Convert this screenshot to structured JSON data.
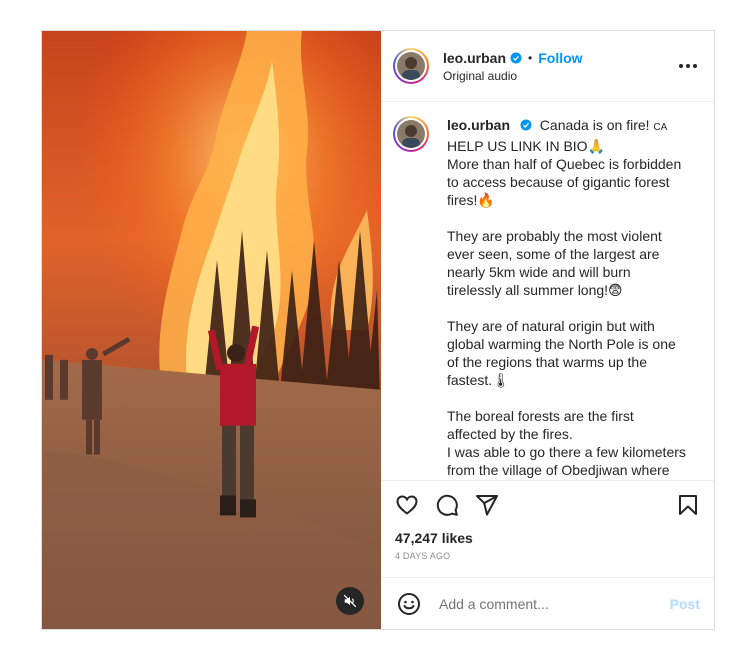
{
  "post": {
    "author": {
      "username": "leo.urban",
      "verified_icon": "verified-badge-icon",
      "separator": "•",
      "follow_label": "Follow",
      "audio_label": "Original audio"
    },
    "media": {
      "description_icon": "wildfire-video",
      "mute_icon": "speaker-muted-icon"
    },
    "caption": {
      "username": "leo.urban",
      "line1": "Canada is on fire!",
      "flag": "CA",
      "line2": "HELP US LINK IN BIO🙏",
      "line3": "More than half of Quebec is forbidden to access because of gigantic forest fires!🔥",
      "para2": "They are probably the most violent ever seen, some of the largest are nearly 5km wide and will burn tirelessly all summer long!😨",
      "para3": "They are of natural origin but with global warming the North Pole is one of the regions that warms up the fastest.🌡",
      "para4_line1": "The boreal forests are the first affected by the fires.",
      "para4_line2": "I was able to go there a few kilometers from the village of Obedjiwan where"
    },
    "likes": "47,247 likes",
    "date": "4 DAYS AGO",
    "comment": {
      "placeholder": "Add a comment...",
      "post_label": "Post"
    },
    "colors": {
      "accent": "#0095f6",
      "post_disabled": "#b3dbff",
      "muted_text": "#8e8e8e"
    }
  }
}
